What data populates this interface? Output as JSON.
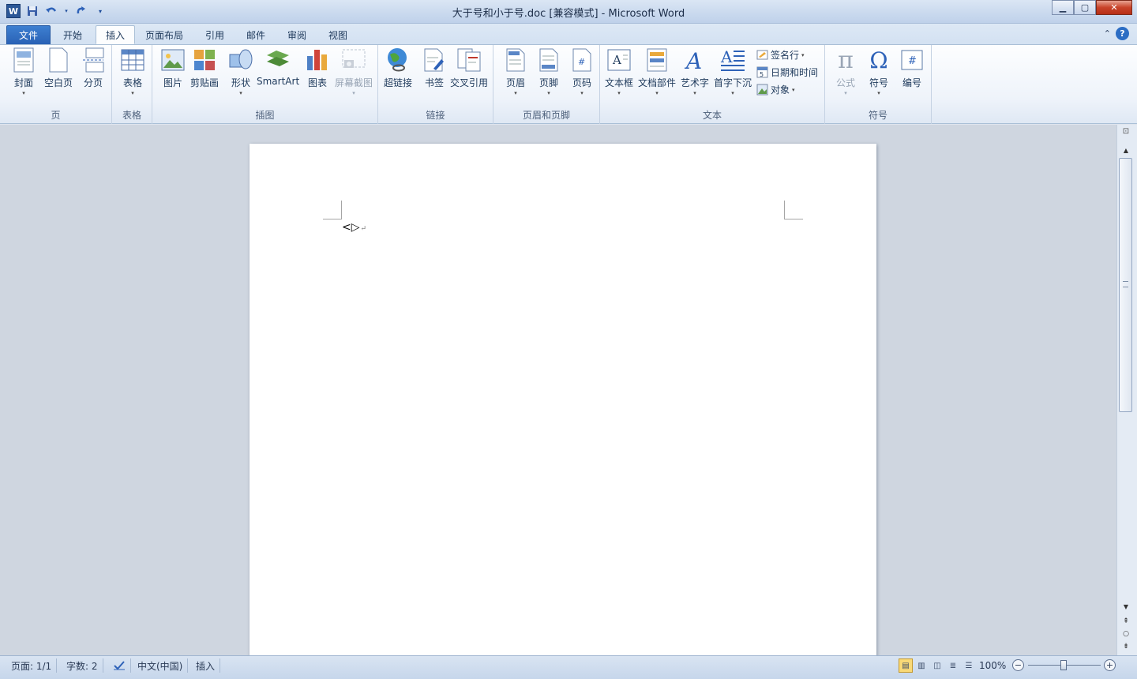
{
  "window": {
    "title": "大于号和小于号.doc [兼容模式] - Microsoft Word",
    "minimize": "▁",
    "maximize": "▢",
    "close": "✕"
  },
  "qat": {
    "logo": "W",
    "save_icon": "save-icon",
    "undo_icon": "undo-icon",
    "redo_icon": "redo-icon"
  },
  "tabs": {
    "file": "文件",
    "home": "开始",
    "insert": "插入",
    "layout": "页面布局",
    "references": "引用",
    "mailings": "邮件",
    "review": "审阅",
    "view": "视图"
  },
  "ribbon": {
    "pages": {
      "label": "页",
      "cover": "封面",
      "blank": "空白页",
      "break": "分页"
    },
    "tables": {
      "label": "表格",
      "table": "表格"
    },
    "illustrations": {
      "label": "插图",
      "picture": "图片",
      "clipart": "剪贴画",
      "shapes": "形状",
      "smartart": "SmartArt",
      "chart": "图表",
      "screenshot": "屏幕截图"
    },
    "links": {
      "label": "链接",
      "hyperlink": "超链接",
      "bookmark": "书签",
      "crossref": "交叉引用"
    },
    "headerfooter": {
      "label": "页眉和页脚",
      "header": "页眉",
      "footer": "页脚",
      "pagenum": "页码"
    },
    "text": {
      "label": "文本",
      "textbox": "文本框",
      "quickparts": "文档部件",
      "wordart": "艺术字",
      "dropcap": "首字下沉",
      "signature": "签名行",
      "datetime": "日期和时间",
      "object": "对象"
    },
    "symbols": {
      "label": "符号",
      "equation": "公式",
      "symbol": "符号",
      "number": "编号"
    }
  },
  "document": {
    "content": "<▷",
    "para_mark": "↵"
  },
  "status": {
    "page": "页面: 1/1",
    "words": "字数: 2",
    "language": "中文(中国)",
    "mode": "插入",
    "zoom": "100%"
  },
  "colors": {
    "file_tab": "#2a62b5",
    "accent": "#1e395b",
    "page": "#ffffff"
  }
}
